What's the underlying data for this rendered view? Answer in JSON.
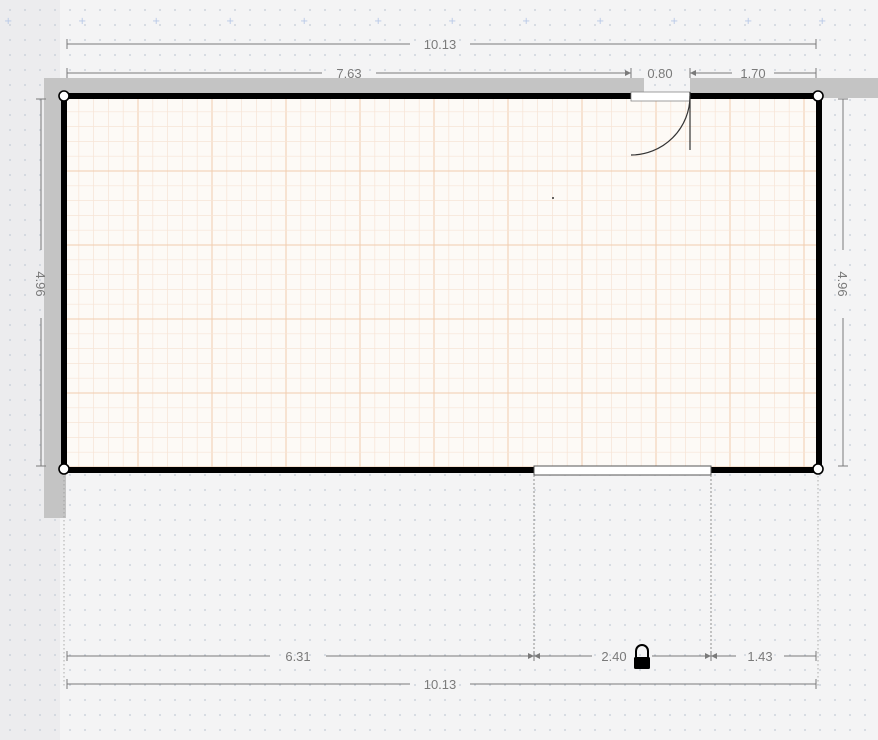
{
  "app": {
    "view": "floor-plan-editor",
    "colors": {
      "background": "#f4f4f5",
      "grid_dot": "#c3cbd6",
      "grid_plus": "#b7c8e6",
      "floor": "#fdfaf6",
      "floor_grid_major": "#f1ccae",
      "floor_grid_minor": "#f7e4d5",
      "wall": "#000000",
      "shadow": "#c4c4c4",
      "dimension": "#7a7a7a"
    }
  },
  "room": {
    "wall_count": 4,
    "door_icon": "door-swing-icon",
    "opening_icon": "opening-rectangle",
    "lock_icon": "padlock-icon"
  },
  "dimensions": {
    "top_total": "10.13",
    "top_segment_left": "7.63",
    "top_segment_door": "0.80",
    "top_segment_right": "1.70",
    "left_height": "4.96",
    "right_height": "4.96",
    "bottom_segment_left": "6.31",
    "bottom_segment_opening": "2.40",
    "bottom_segment_right": "1.43",
    "bottom_total": "10.13"
  }
}
